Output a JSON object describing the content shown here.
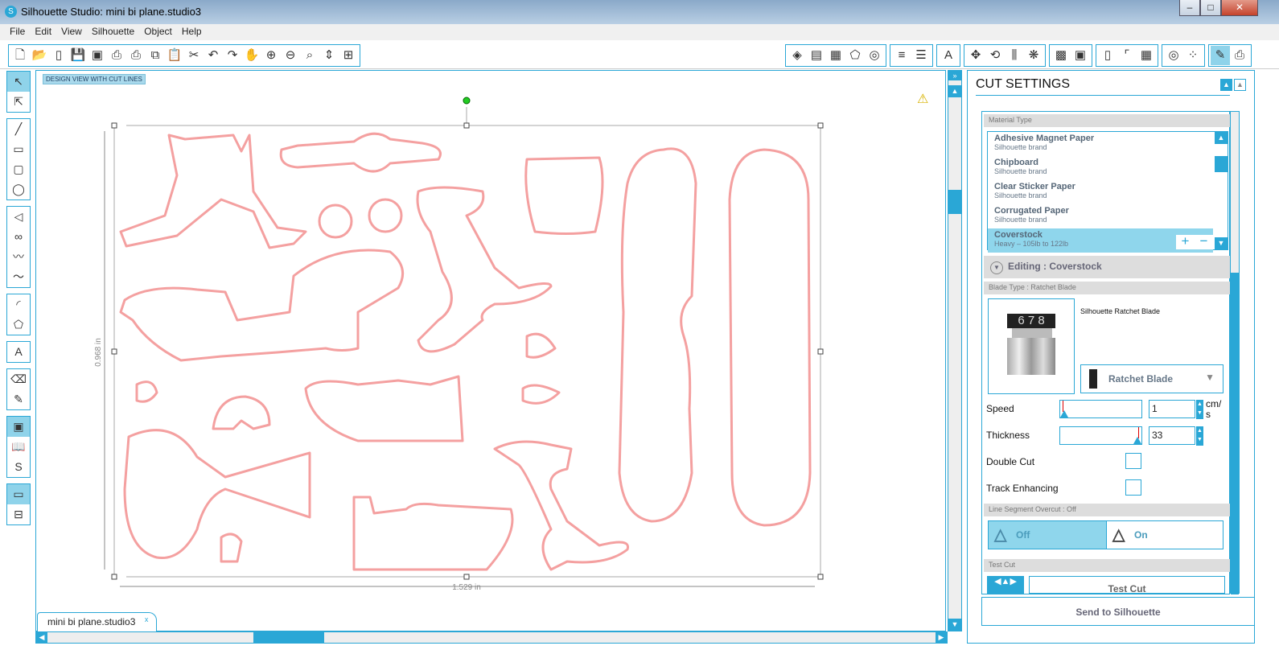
{
  "window": {
    "title": "Silhouette Studio: mini bi plane.studio3",
    "controls": [
      "–",
      "□",
      "✕"
    ]
  },
  "menu": [
    "File",
    "Edit",
    "View",
    "Silhouette",
    "Object",
    "Help"
  ],
  "toolbar": {
    "left_group": [
      "new-icon",
      "open-icon",
      "device-icon",
      "save-icon",
      "save-library-icon",
      "print-icon",
      "print-cut-icon",
      "copy-icon",
      "paste-icon",
      "cut-icon",
      "undo-icon",
      "redo-icon",
      "pan-icon",
      "zoom-in-icon",
      "zoom-out-icon",
      "zoom-select-icon",
      "zoom-drag-icon",
      "fit-page-icon"
    ],
    "right_groups": [
      [
        "fill-icon",
        "gradient-icon",
        "pattern-icon",
        "line-style-icon",
        "line-color-icon"
      ],
      [
        "line-color-bars-icon",
        "line-style-bars-icon"
      ],
      [
        "text-style-icon"
      ],
      [
        "transform-icon",
        "rotate-icon",
        "align-icon",
        "replicate-icon"
      ],
      [
        "library-icon",
        "store-icon"
      ],
      [
        "page-setup-icon",
        "registration-icon",
        "grid-icon"
      ],
      [
        "offset-icon",
        "trace-icon"
      ],
      [
        "cut-settings-icon",
        "send-icon"
      ]
    ]
  },
  "left_tools": [
    "select-icon",
    "point-edit-icon",
    "line-icon",
    "rectangle-icon",
    "rounded-rectangle-icon",
    "ellipse-icon",
    "polygon-icon",
    "curve-icon",
    "freehand-icon",
    "smooth-freehand-icon",
    "arc-icon",
    "regular-polygon-icon",
    "text-icon",
    "eraser-icon",
    "knife-icon",
    "cut-view-icon",
    "library-view-icon",
    "store-view-icon",
    "design-window-icon",
    "split-view-icon"
  ],
  "canvas": {
    "view_label": "DESIGN VIEW WITH CUT LINES",
    "height_label": "0.968 in",
    "width_label": "1.529 in",
    "cut_color": "#f4a0a0",
    "warning": "warning-icon"
  },
  "doc_tab": {
    "label": "mini bi plane.studio3",
    "close": "x"
  },
  "cut_settings": {
    "title": "CUT SETTINGS",
    "material_header": "Material Type",
    "materials": [
      {
        "name": "Adhesive Magnet Paper",
        "sub": "Silhouette brand"
      },
      {
        "name": "Chipboard",
        "sub": "Silhouette brand"
      },
      {
        "name": "Clear Sticker Paper",
        "sub": "Silhouette brand"
      },
      {
        "name": "Corrugated Paper",
        "sub": "Silhouette brand"
      },
      {
        "name": "Coverstock",
        "sub": "Heavy – 105lb to 122lb",
        "selected": true
      }
    ],
    "editing": "Editing : Coverstock",
    "blade_header": "Blade Type : Ratchet Blade",
    "blade_name": "Silhouette Ratchet Blade",
    "blade_digits": "6 7 8",
    "blade_select": "Ratchet Blade",
    "speed_label": "Speed",
    "speed_value": "1",
    "speed_unit": "cm/ s",
    "thickness_label": "Thickness",
    "thickness_value": "33",
    "double_cut_label": "Double Cut",
    "double_cut": false,
    "track_label": "Track Enhancing",
    "track": false,
    "overcut_header": "Line Segment Overcut : Off",
    "overcut_off": "Off",
    "overcut_on": "On",
    "test_header": "Test Cut",
    "test_button": "Test Cut",
    "send_button": "Send to Silhouette",
    "accent": "#2aa7d6"
  }
}
